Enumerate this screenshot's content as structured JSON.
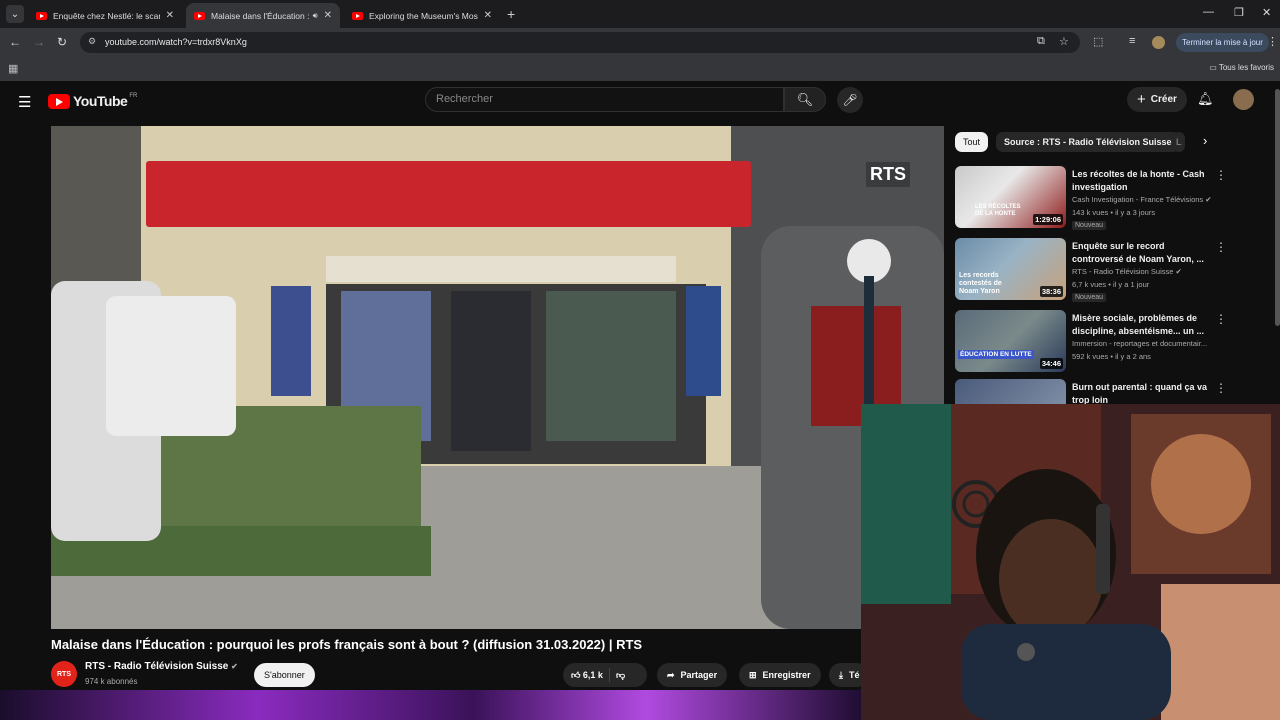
{
  "browser": {
    "tabs": [
      {
        "title": "Enquête chez Nestlé: le scandal",
        "active": false
      },
      {
        "title": "Malaise dans l'Éducation : p",
        "active": true
      },
      {
        "title": "Exploring the Museum's Most F",
        "active": false
      }
    ],
    "url": "youtube.com/watch?v=trdxr8VknXg",
    "update_label": "Terminer la mise à jour",
    "bookmarks_label": "Tous les favoris"
  },
  "youtube": {
    "logo_text": "YouTube",
    "country_code": "FR",
    "search_placeholder": "Rechercher",
    "create_label": "Créer"
  },
  "video": {
    "title": "Malaise dans l'Éducation : pourquoi les profs français sont à bout ? (diffusion 31.03.2022) | RTS",
    "watermark": "RTS",
    "channel_name": "RTS - Radio Télévision Suisse",
    "channel_avatar_text": "RTS",
    "subscribers": "974 k abonnés",
    "subscribe_label": "S'abonner",
    "likes": "6,1 k",
    "share_label": "Partager",
    "save_label": "Enregistrer",
    "download_label_partial": "Té"
  },
  "chips": [
    {
      "label": "Tout",
      "selected": true
    },
    {
      "label": "Source : RTS - Radio Télévision Suisse",
      "selected": false
    },
    {
      "label": "L",
      "selected": false
    }
  ],
  "recommendations": [
    {
      "title": "Les récoltes de la honte - Cash investigation",
      "channel": "Cash Investigation - France Télévisions",
      "verified": true,
      "stats": "143 k vues • il y a 3 jours",
      "badge": "Nouveau",
      "duration": "1:29:06",
      "thumb_caption": "LES RÉCOLTES DE LA HONTE"
    },
    {
      "title": "Enquête sur le record controversé de Noam Yaron, ...",
      "channel": "RTS - Radio Télévision Suisse",
      "verified": true,
      "stats": "6,7 k vues • il y a 1 jour",
      "badge": "Nouveau",
      "duration": "38:36",
      "thumb_caption": "Les records contestés de Noam Yaron"
    },
    {
      "title": "Misère sociale, problèmes de discipline, absentéisme... un ...",
      "channel": "Immersion - reportages et documentair...",
      "verified": false,
      "stats": "592 k vues • il y a 2 ans",
      "badge": "",
      "duration": "34:46",
      "thumb_caption": "ÉDUCATION EN LUTTE"
    },
    {
      "title": "Burn out parental : quand ça va trop loin",
      "channel": "",
      "verified": false,
      "stats": "",
      "badge": "",
      "duration": "",
      "thumb_caption": ""
    }
  ],
  "colors": {
    "yt_red": "#ff0000",
    "bg": "#0f0f0f",
    "chip_bg": "#272727"
  }
}
